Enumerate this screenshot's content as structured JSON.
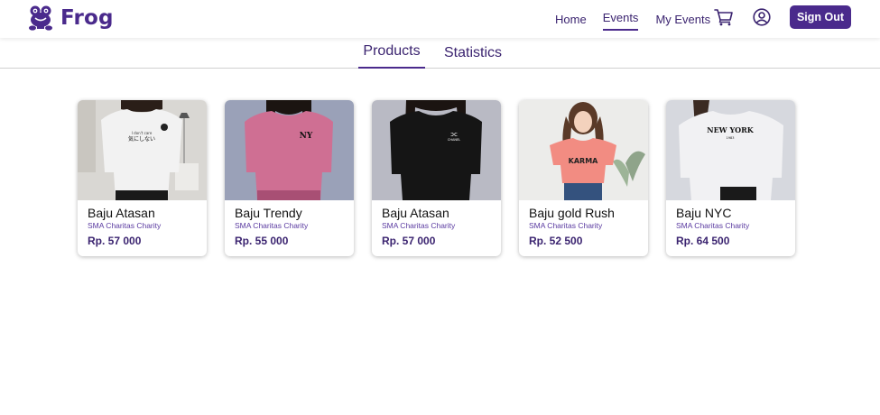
{
  "brand": {
    "name": "Frog",
    "icon": "frog-logo-icon"
  },
  "nav": {
    "home": "Home",
    "events": "Events",
    "my_events": "My Events",
    "sign_out": "Sign Out",
    "active": "Events"
  },
  "icons": {
    "cart": "cart-icon",
    "user": "user-circle-icon"
  },
  "colors": {
    "primary": "#4a2a8c",
    "text": "#3b2470"
  },
  "tabs": [
    {
      "label": "Products",
      "active": true
    },
    {
      "label": "Statistics",
      "active": false
    }
  ],
  "products": [
    {
      "name": "Baju Atasan",
      "seller": "SMA Charitas Charity",
      "price": "Rp. 57 000",
      "shirt_color": "#f2f2f2",
      "print": "I don't care 気にしない"
    },
    {
      "name": "Baju Trendy",
      "seller": "SMA Charitas Charity",
      "price": "Rp. 55 000",
      "shirt_color": "#cf6f93",
      "print": "NY"
    },
    {
      "name": "Baju Atasan",
      "seller": "SMA Charitas Charity",
      "price": "Rp. 57 000",
      "shirt_color": "#151515",
      "print": "CHANEL"
    },
    {
      "name": "Baju gold Rush",
      "seller": "SMA Charitas Charity",
      "price": "Rp. 52 500",
      "shirt_color": "#f28c82",
      "print": "KARMA"
    },
    {
      "name": "Baju NYC",
      "seller": "SMA Charitas Charity",
      "price": "Rp. 64 500",
      "shirt_color": "#f1f1f3",
      "print": "NEW YORK 1983"
    }
  ]
}
